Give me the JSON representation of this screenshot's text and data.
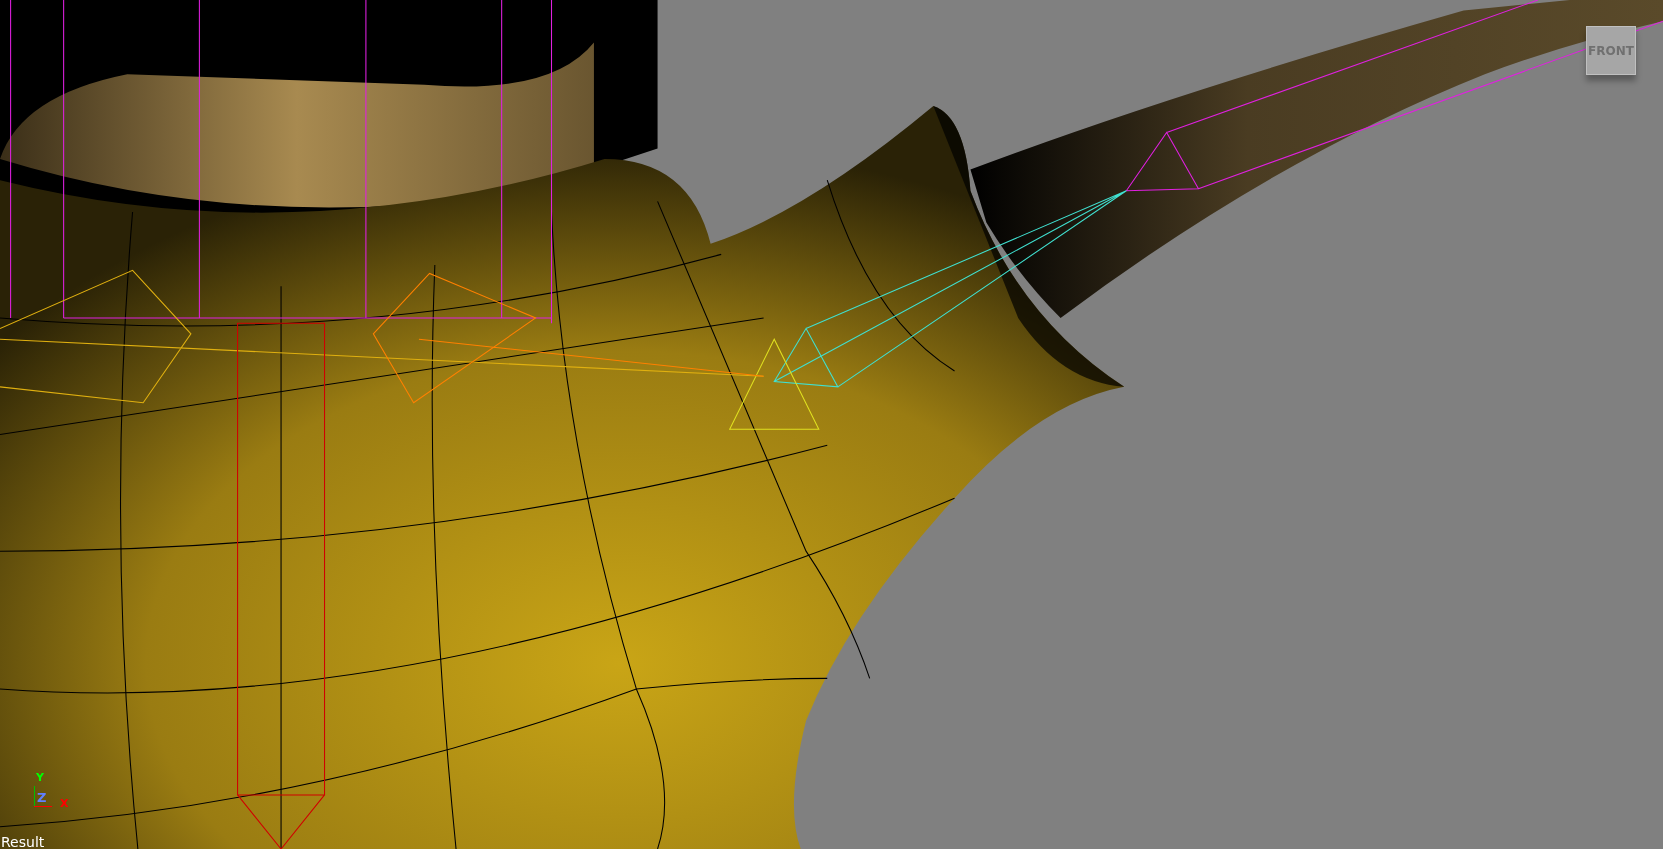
{
  "viewport": {
    "label": "Result"
  },
  "view_cube": {
    "label": "FRONT"
  },
  "axis_gizmo": {
    "y": "Y",
    "z": "Z",
    "x": "X"
  }
}
